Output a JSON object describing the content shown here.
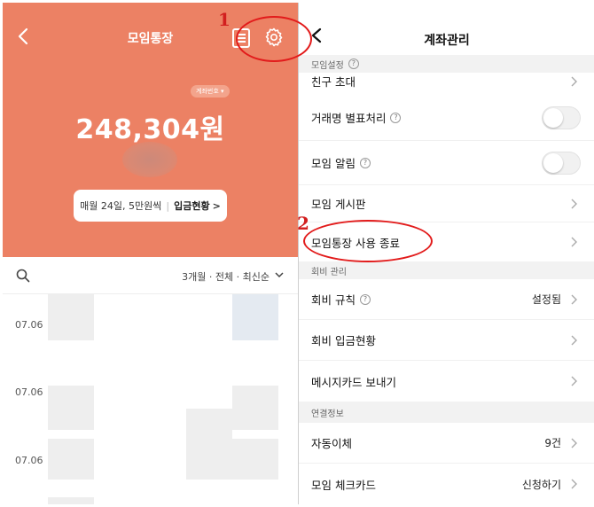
{
  "left": {
    "header": {
      "title": "모임통장",
      "back_icon": "chevron-left-icon",
      "doc_icon": "document-list-icon",
      "settings_icon": "gear-icon"
    },
    "account_pill": "계좌번호",
    "balance": "248,304원",
    "deposit_card": {
      "schedule": "매월 24일, 5만원씩",
      "status_label": "입금현황",
      "chevron": ">"
    },
    "filter": {
      "text": "3개월 · 전체 · 최신순",
      "search_icon": "search-icon"
    },
    "transactions": [
      {
        "date": "07.06"
      },
      {
        "date": "07.06"
      },
      {
        "date": "07.06"
      }
    ]
  },
  "annotations": {
    "marker_1": "1",
    "marker_2": "2",
    "color": "#e21b1b"
  },
  "right": {
    "header": {
      "title": "계좌관리",
      "back_icon": "chevron-left-icon"
    },
    "sections": {
      "group_settings": "모임설정",
      "fee_management": "회비 관리",
      "connection_info": "연결정보"
    },
    "rows": {
      "invite": "친구 초대",
      "tx_name_separate": "거래명 별표처리",
      "group_alert": "모임 알림",
      "board": "모임 게시판",
      "end_usage": "모임통장 사용 종료",
      "fee_rules": "회비 규칙",
      "fee_rules_value": "설정됨",
      "fee_deposit_status": "회비 입금현황",
      "message_card": "메시지카드 보내기",
      "auto_transfer": "자동이체",
      "auto_transfer_value": "9건",
      "check_card": "모임 체크카드",
      "check_card_value": "신청하기"
    },
    "toggles": {
      "tx_name_separate": false,
      "group_alert": false
    }
  },
  "colors": {
    "brand": "#ec8164",
    "accent_red": "#e21b1b"
  }
}
